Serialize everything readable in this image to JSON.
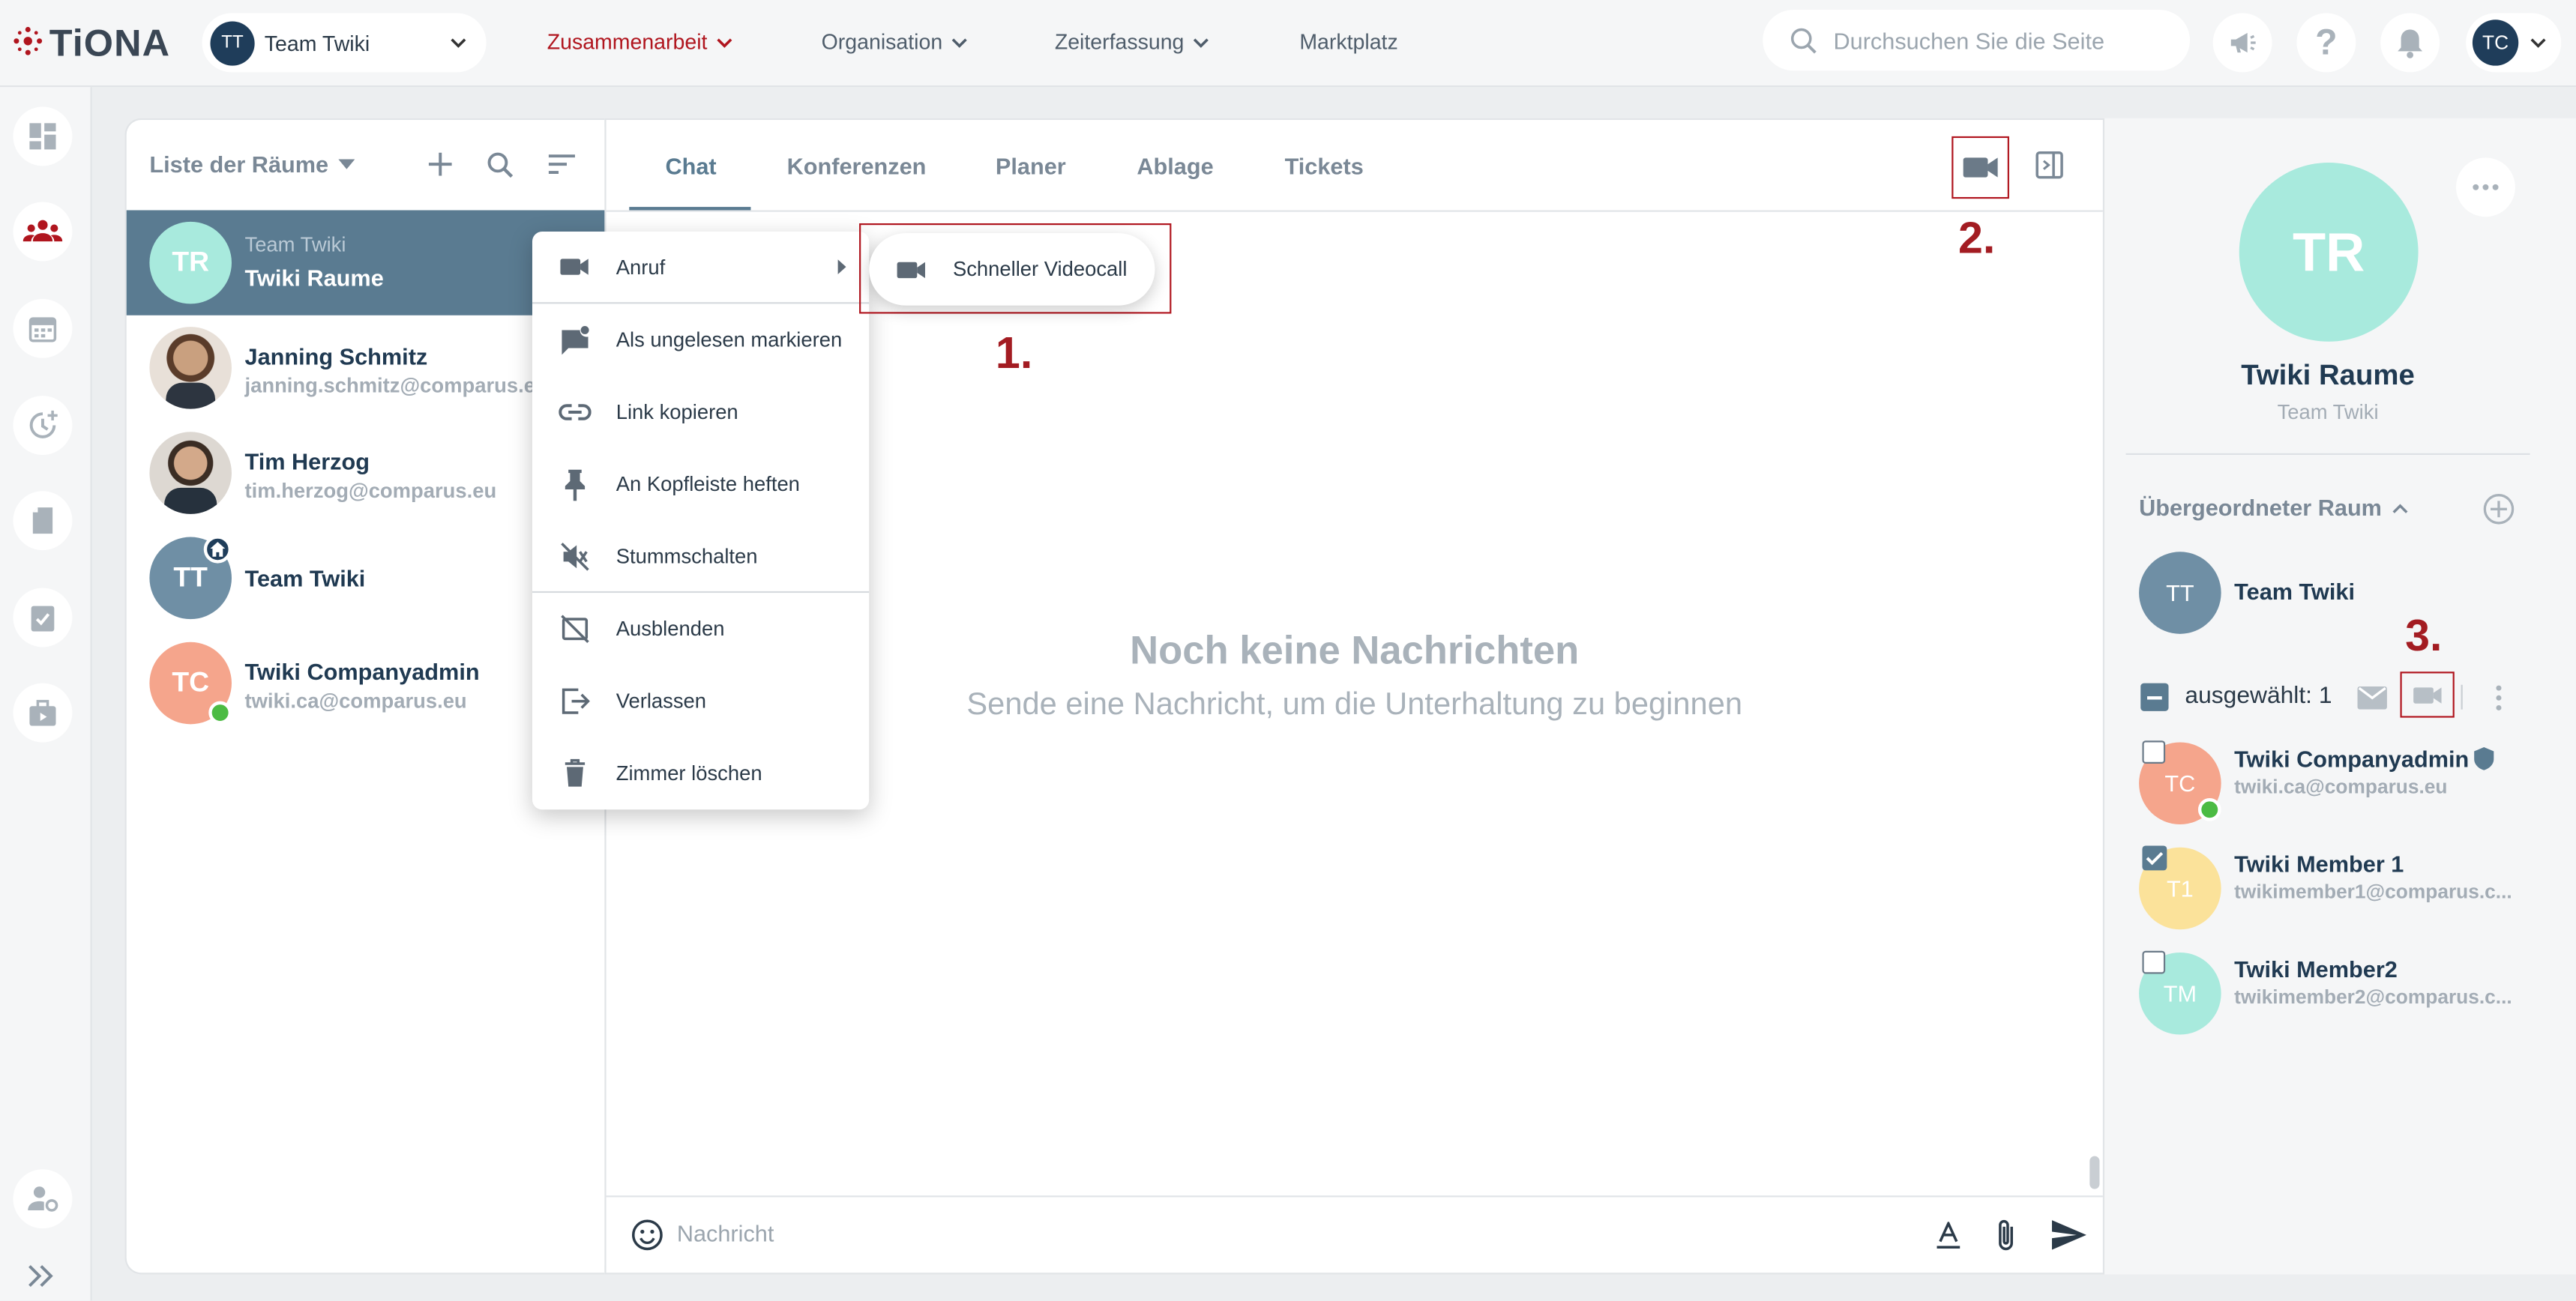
{
  "brand": {
    "name": "TiONA",
    "accent": "#b0151e"
  },
  "header": {
    "team_selector": {
      "initials": "TT",
      "label": "Team Twiki"
    },
    "nav": [
      {
        "label": "Zusammenarbeit",
        "active": true
      },
      {
        "label": "Organisation"
      },
      {
        "label": "Zeiterfassung"
      },
      {
        "label": "Marktplatz"
      }
    ],
    "search_placeholder": "Durchsuchen Sie die Seite",
    "user_initials": "TC"
  },
  "rooms_panel": {
    "title": "Liste der Räume",
    "rooms": [
      {
        "initials": "TR",
        "team": "Team Twiki",
        "name": "Twiki Raume",
        "selected": true
      },
      {
        "name": "Janning Schmitz",
        "email": "janning.schmitz@comparus.eu"
      },
      {
        "name": "Tim Herzog",
        "email": "tim.herzog@comparus.eu"
      },
      {
        "initials": "TT",
        "name": "Team Twiki"
      },
      {
        "initials": "TC",
        "name": "Twiki Companyadmin",
        "email": "twiki.ca@comparus.eu"
      }
    ]
  },
  "context_menu": {
    "items": [
      "Anruf",
      "Als ungelesen markieren",
      "Link kopieren",
      "An Kopfleiste heften",
      "Stummschalten",
      "Ausblenden",
      "Verlassen",
      "Zimmer löschen"
    ],
    "submenu": "Schneller Videocall"
  },
  "chat": {
    "tabs": [
      "Chat",
      "Konferenzen",
      "Planer",
      "Ablage",
      "Tickets"
    ],
    "empty_title": "Noch keine Nachrichten",
    "empty_sub": "Sende eine Nachricht, um die Unterhaltung zu beginnen",
    "input_placeholder": "Nachricht"
  },
  "right_panel": {
    "initials": "TR",
    "name": "Twiki Raume",
    "team": "Team Twiki",
    "parent_label": "Übergeordneter Raum",
    "parent": {
      "initials": "TT",
      "name": "Team Twiki"
    },
    "selected_label": "ausgewählt: 1",
    "members": [
      {
        "initials": "TC",
        "name": "Twiki Companyadmin",
        "email": "twiki.ca@comparus.eu",
        "checked": false
      },
      {
        "initials": "T1",
        "name": "Twiki Member 1",
        "email": "twikimember1@comparus.c...",
        "checked": true
      },
      {
        "initials": "TM",
        "name": "Twiki Member2",
        "email": "twikimember2@comparus.c...",
        "checked": false
      }
    ]
  },
  "annotations": [
    "1.",
    "2.",
    "3."
  ]
}
